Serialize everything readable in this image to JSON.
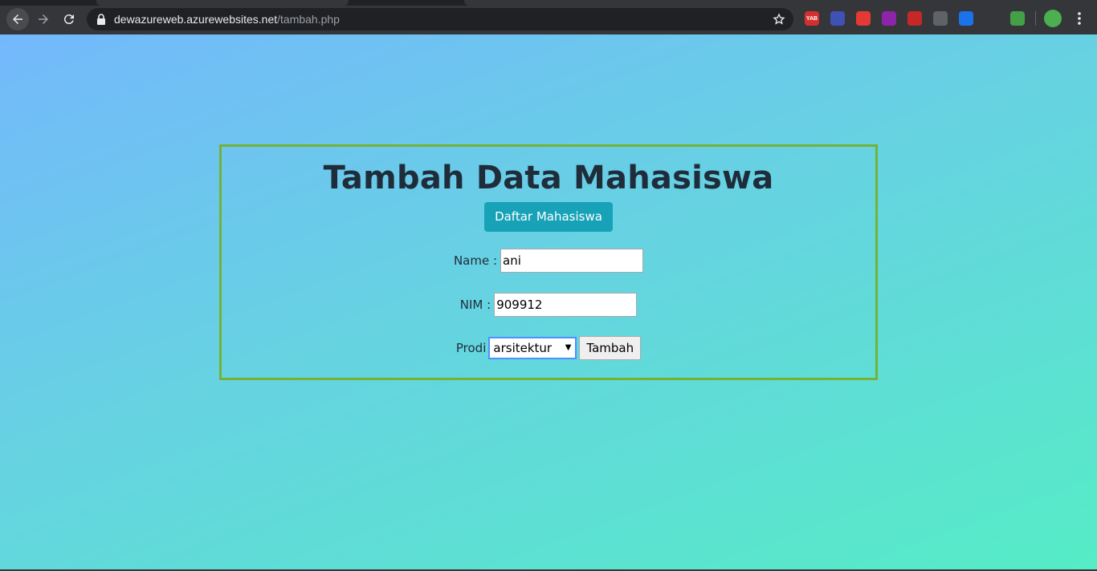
{
  "browser": {
    "url_host": "dewazureweb.azurewebsites.net",
    "url_path": "/tambah.php",
    "extensions": [
      {
        "icon": "yab-icon",
        "label": "YAB",
        "color": "#d32f2f"
      },
      {
        "icon": "circle-ext-icon",
        "label": "",
        "color": "#3f51b5"
      },
      {
        "icon": "shield-ext-icon",
        "label": "",
        "color": "#e53935"
      },
      {
        "icon": "instagram-ext-icon",
        "label": "",
        "color": "#8e24aa"
      },
      {
        "icon": "fast-forward-ext-icon",
        "label": "",
        "color": "#c62828"
      },
      {
        "icon": "glasses-ext-icon",
        "label": "",
        "color": "#5f6368"
      },
      {
        "icon": "translate-ext-icon",
        "label": "",
        "color": "#1a73e8"
      },
      {
        "icon": "react-ext-icon",
        "label": "",
        "color": "#35363a"
      },
      {
        "icon": "leaf-ext-icon",
        "label": "",
        "color": "#43a047"
      }
    ]
  },
  "page": {
    "title": "Tambah Data Mahasiswa",
    "list_button": "Daftar Mahasiswa",
    "name_label": "Name :",
    "name_value": "ani",
    "nim_label": "NIM :",
    "nim_value": "909912",
    "prodi_label": "Prodi",
    "prodi_value": "arsitektur",
    "submit_label": "Tambah"
  }
}
